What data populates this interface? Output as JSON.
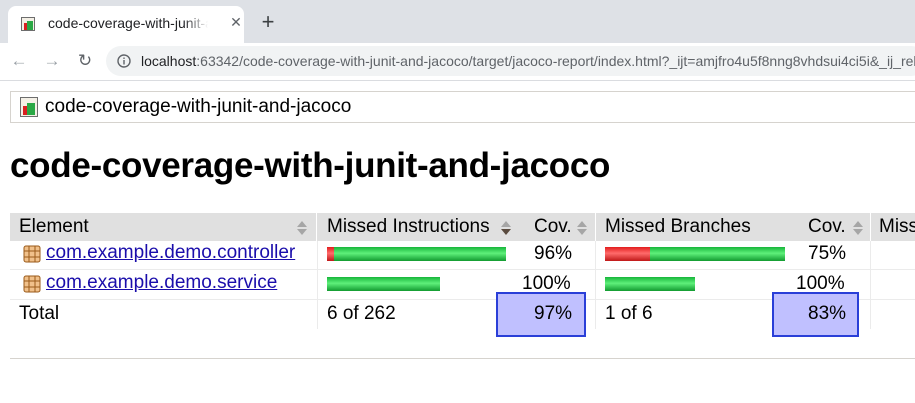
{
  "browser": {
    "tab_title": "code-coverage-with-junit-and-jacoco",
    "close_glyph": "✕",
    "newtab_glyph": "+",
    "back_glyph": "←",
    "forward_glyph": "→",
    "reload_glyph": "↻",
    "url_host": "localhost",
    "url_rest": ":63342/code-coverage-with-junit-and-jacoco/target/jacoco-report/index.html?_ijt=amjfro4u5f8nng8vhdsui4ci5i&_ij_reload"
  },
  "breadcrumb": {
    "label": "code-coverage-with-junit-and-jacoco"
  },
  "page": {
    "title": "code-coverage-with-junit-and-jacoco"
  },
  "table": {
    "headers": {
      "element": "Element",
      "missed_instructions": "Missed Instructions",
      "cov1": "Cov.",
      "missed_branches": "Missed Branches",
      "cov2": "Cov.",
      "missed_cut": "Miss"
    },
    "rows": [
      {
        "name": "com.example.demo.controller",
        "instr_missed_fraction": 0.04,
        "instr_cov": "96%",
        "branch_missed_fraction": 0.25,
        "branch_cov": "75%"
      },
      {
        "name": "com.example.demo.service",
        "instr_missed_fraction": 0,
        "instr_cov": "100%",
        "branch_missed_fraction": 0,
        "branch_cov": "100%"
      }
    ],
    "total": {
      "label": "Total",
      "instr": "6 of 262",
      "instr_cov": "97%",
      "branch": "1 of 6",
      "branch_cov": "83%"
    }
  },
  "colors": {
    "missed": "#e21d1d",
    "covered": "#17b53a",
    "highlight_fill": "#c0c0ff",
    "highlight_border": "#2a3fd8",
    "header_bg": "#e0e0e0",
    "link": "#1a0dab"
  },
  "icons": {
    "tab_favicon": "jacoco-report-icon",
    "breadcrumb": "jacoco-report-icon",
    "package": "package-icon",
    "info": "info-icon",
    "sort": "sort-arrows-icon"
  }
}
